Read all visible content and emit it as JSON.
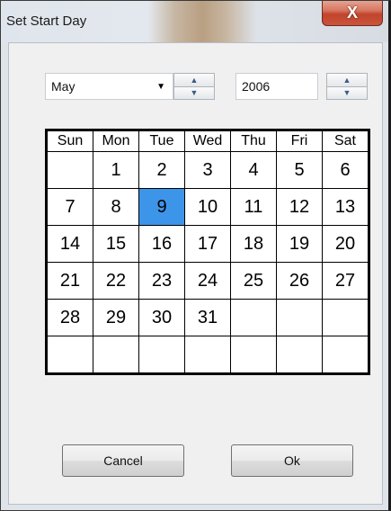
{
  "window": {
    "title": "Set Start Day",
    "close_label": "X"
  },
  "month_select": {
    "value": "May",
    "arrow": "▼"
  },
  "year_field": {
    "value": "2006"
  },
  "spinner": {
    "up": "▲",
    "down": "▼"
  },
  "calendar": {
    "weekday_headers": [
      "Sun",
      "Mon",
      "Tue",
      "Wed",
      "Thu",
      "Fri",
      "Sat"
    ],
    "weeks": [
      [
        "",
        "1",
        "2",
        "3",
        "4",
        "5",
        "6"
      ],
      [
        "7",
        "8",
        "9",
        "10",
        "11",
        "12",
        "13"
      ],
      [
        "14",
        "15",
        "16",
        "17",
        "18",
        "19",
        "20"
      ],
      [
        "21",
        "22",
        "23",
        "24",
        "25",
        "26",
        "27"
      ],
      [
        "28",
        "29",
        "30",
        "31",
        "",
        "",
        ""
      ],
      [
        "",
        "",
        "",
        "",
        "",
        "",
        ""
      ]
    ],
    "selected_day": "9",
    "selected_color": "#3d95e9"
  },
  "buttons": {
    "cancel_label": "Cancel",
    "ok_label": "Ok"
  }
}
